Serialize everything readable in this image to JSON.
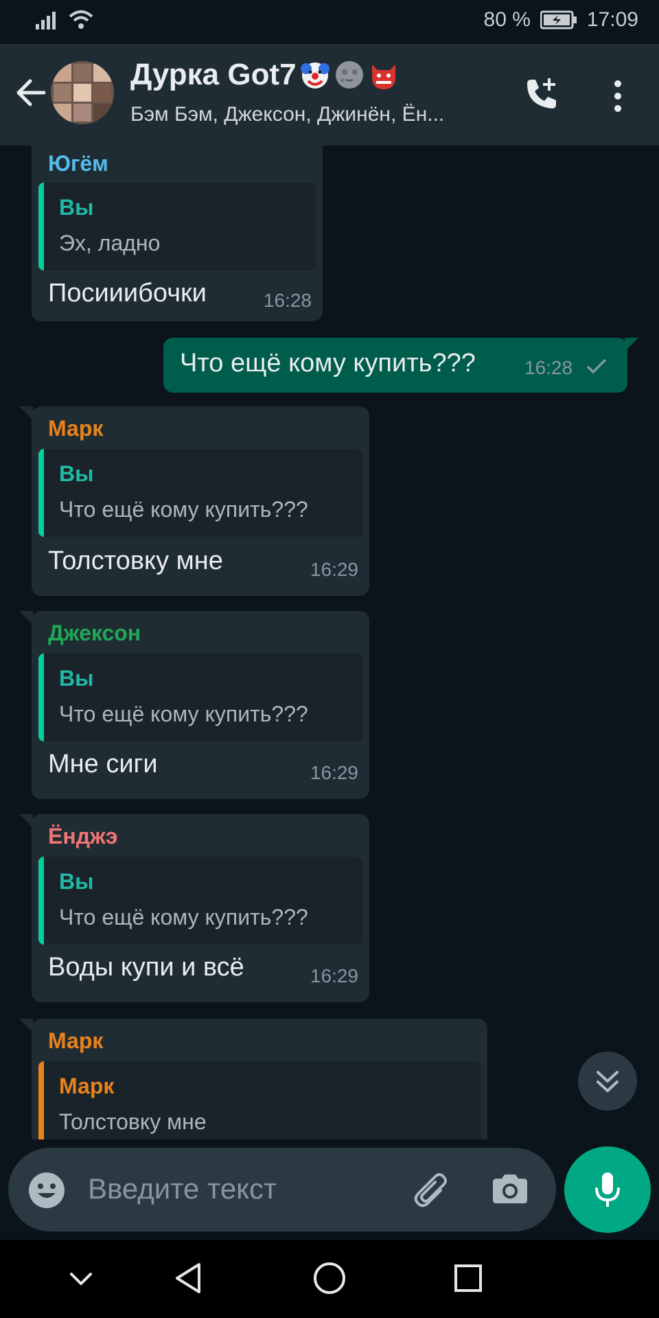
{
  "status_bar": {
    "battery_percent": "80 %",
    "time": "17:09"
  },
  "header": {
    "title": "Дурка Got7",
    "emojis": [
      "clown-face-icon",
      "new-moon-face-icon",
      "ogre-icon"
    ],
    "subtitle": "Бэм Бэм, Джексон, Джинён, Ён..."
  },
  "messages": [
    {
      "sender": "Югём",
      "sender_color": "#53bdeb",
      "quote_name": "Вы",
      "quote_text": "Эх, ладно",
      "text": "Посииибочки",
      "time": "16:28"
    },
    {
      "text": "Что ещё кому купить???",
      "time": "16:28",
      "status": "sent-check-icon"
    },
    {
      "sender": "Марк",
      "sender_color": "#e9821b",
      "quote_name": "Вы",
      "quote_text": "Что ещё кому купить???",
      "text": "Толстовку мне",
      "time": "16:29"
    },
    {
      "sender": "Джексон",
      "sender_color": "#1fa855",
      "quote_name": "Вы",
      "quote_text": "Что ещё кому купить???",
      "text": "Мне сиги",
      "time": "16:29"
    },
    {
      "sender": "Ёнджэ",
      "sender_color": "#f07575",
      "quote_name": "Вы",
      "quote_text": "Что ещё кому купить???",
      "text": "Воды купи и всё",
      "time": "16:29"
    },
    {
      "sender": "Марк",
      "sender_color": "#e9821b",
      "quote_name": "Марк",
      "quote_text": "Толстовку мне",
      "quote_color": "#e9821b"
    }
  ],
  "input": {
    "placeholder": "Введите текст"
  },
  "colors": {
    "header_bg": "#202c33",
    "chat_bg": "#0b141a",
    "incoming_bubble": "#202c33",
    "outgoing_bubble": "#005c4b",
    "accent": "#00a884"
  }
}
